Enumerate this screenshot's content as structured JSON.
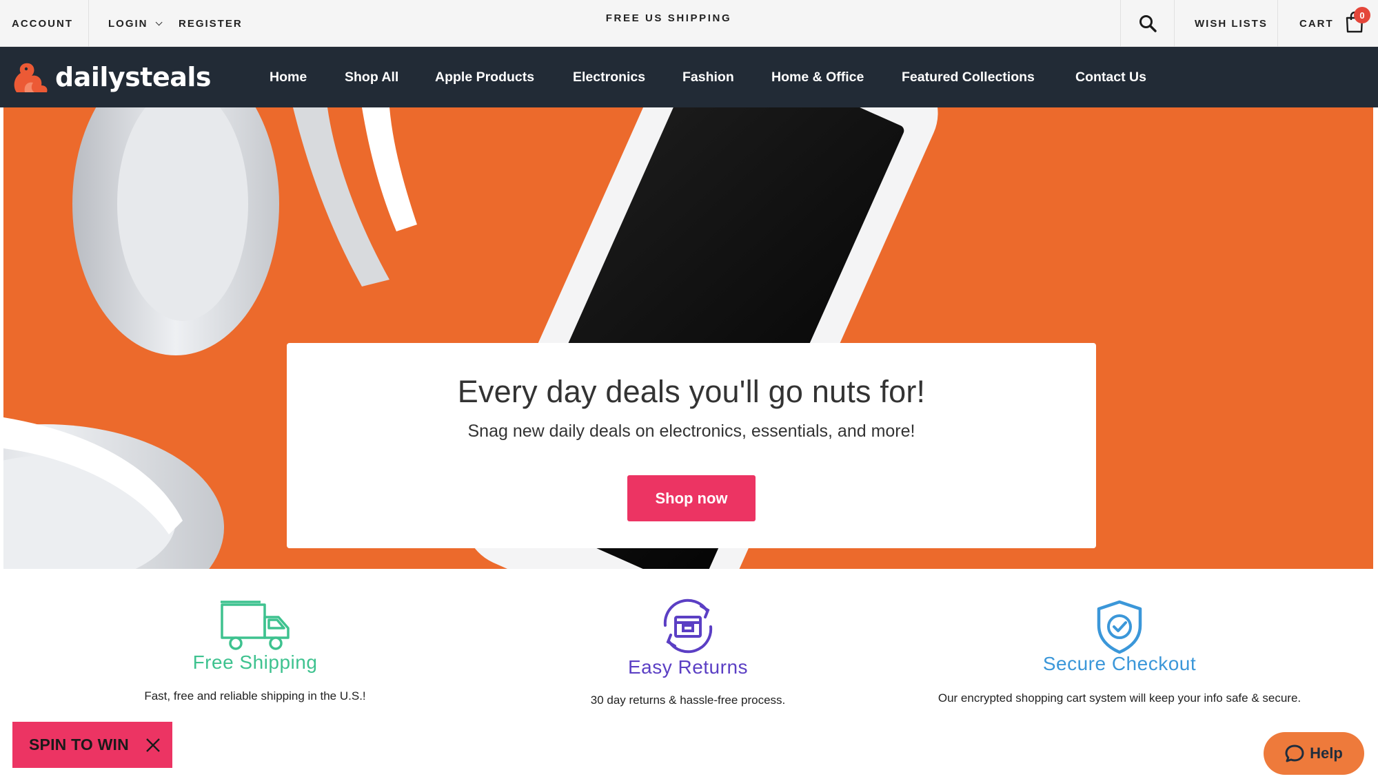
{
  "topbar": {
    "account": "ACCOUNT",
    "login": "LOGIN",
    "register": "REGISTER",
    "announcement": "FREE US SHIPPING",
    "wish_lists": "WISH LISTS",
    "cart": "CART",
    "cart_count": "0"
  },
  "brand": {
    "name": "dailysteals"
  },
  "nav": {
    "items": [
      "Home",
      "Shop All",
      "Apple Products",
      "Electronics",
      "Fashion",
      "Home & Office",
      "Featured Collections",
      "Contact Us"
    ]
  },
  "hero": {
    "title": "Every day deals you'll go nuts for!",
    "subtitle": "Snag new daily deals on electronics, essentials, and more!",
    "cta": "Shop now"
  },
  "features": [
    {
      "title": "Free Shipping",
      "description": "Fast, free and reliable shipping in the U.S.!",
      "icon": "truck-icon"
    },
    {
      "title": "Easy Returns",
      "description": "30 day returns & hassle-free process.",
      "icon": "returns-box-icon"
    },
    {
      "title": "Secure Checkout",
      "description": "Our encrypted shopping cart system will keep your info safe & secure.",
      "icon": "shield-check-icon"
    }
  ],
  "widgets": {
    "spin_to_win": "SPIN TO WIN",
    "help": "Help"
  },
  "colors": {
    "nav_bg": "#222b36",
    "hero_bg": "#ec6a2c",
    "cta": "#ec3463",
    "shipping_green": "#3ec28f",
    "returns_purple": "#5b3fc4",
    "secure_blue": "#3b97d9",
    "help_orange": "#ee7a3b"
  }
}
